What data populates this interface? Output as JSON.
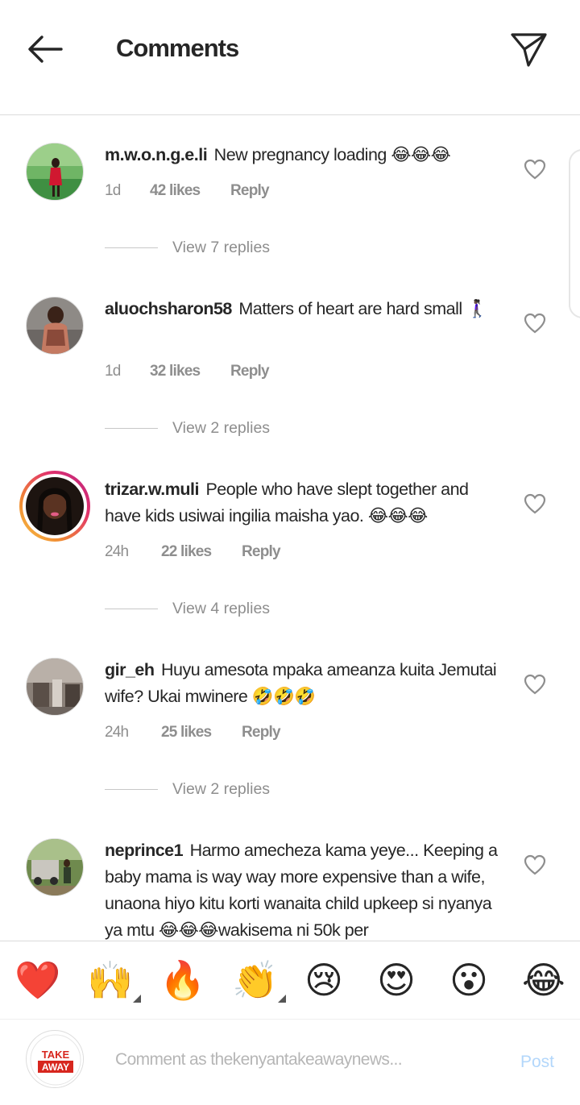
{
  "header": {
    "title": "Comments"
  },
  "comments": [
    {
      "username": "m.w.o.n.g.e.li",
      "text": "New pregnancy loading 😂😂😂",
      "time": "1d",
      "likes": "42 likes",
      "reply": "Reply",
      "view_replies": "View 7 replies"
    },
    {
      "username": "aluochsharon58",
      "text": "Matters of heart are hard small 🚶🏿‍♀️",
      "time": "1d",
      "likes": "32 likes",
      "reply": "Reply",
      "view_replies": "View 2 replies"
    },
    {
      "username": "trizar.w.muli",
      "text": "People who have slept together and have kids usiwai ingilia maisha yao. 😂😂😂",
      "time": "24h",
      "likes": "22 likes",
      "reply": "Reply",
      "view_replies": "View 4 replies"
    },
    {
      "username": "gir_eh",
      "text": "Huyu amesota mpaka ameanza kuita Jemutai wife? Ukai mwinere 🤣🤣🤣",
      "time": "24h",
      "likes": "25 likes",
      "reply": "Reply",
      "view_replies": "View 2 replies"
    },
    {
      "username": "neprince1",
      "text": "Harmo amecheza kama yeye... Keeping a baby mama is way way more expensive than a wife, unaona hiyo kitu korti wanaita child upkeep si nyanya ya mtu 😂😂😂wakisema ni 50k per"
    }
  ],
  "emojis": [
    "❤️",
    "🙌",
    "🔥",
    "👏",
    "😢",
    "😍",
    "😮",
    "😂"
  ],
  "composer": {
    "placeholder": "Comment as thekenyantakeawaynews...",
    "post_label": "Post",
    "avatar_line1": "TAKE",
    "avatar_line2": "AWAY"
  },
  "icons": {
    "back": "arrow-left-icon",
    "send": "paper-plane-icon",
    "like": "heart-outline-icon"
  }
}
